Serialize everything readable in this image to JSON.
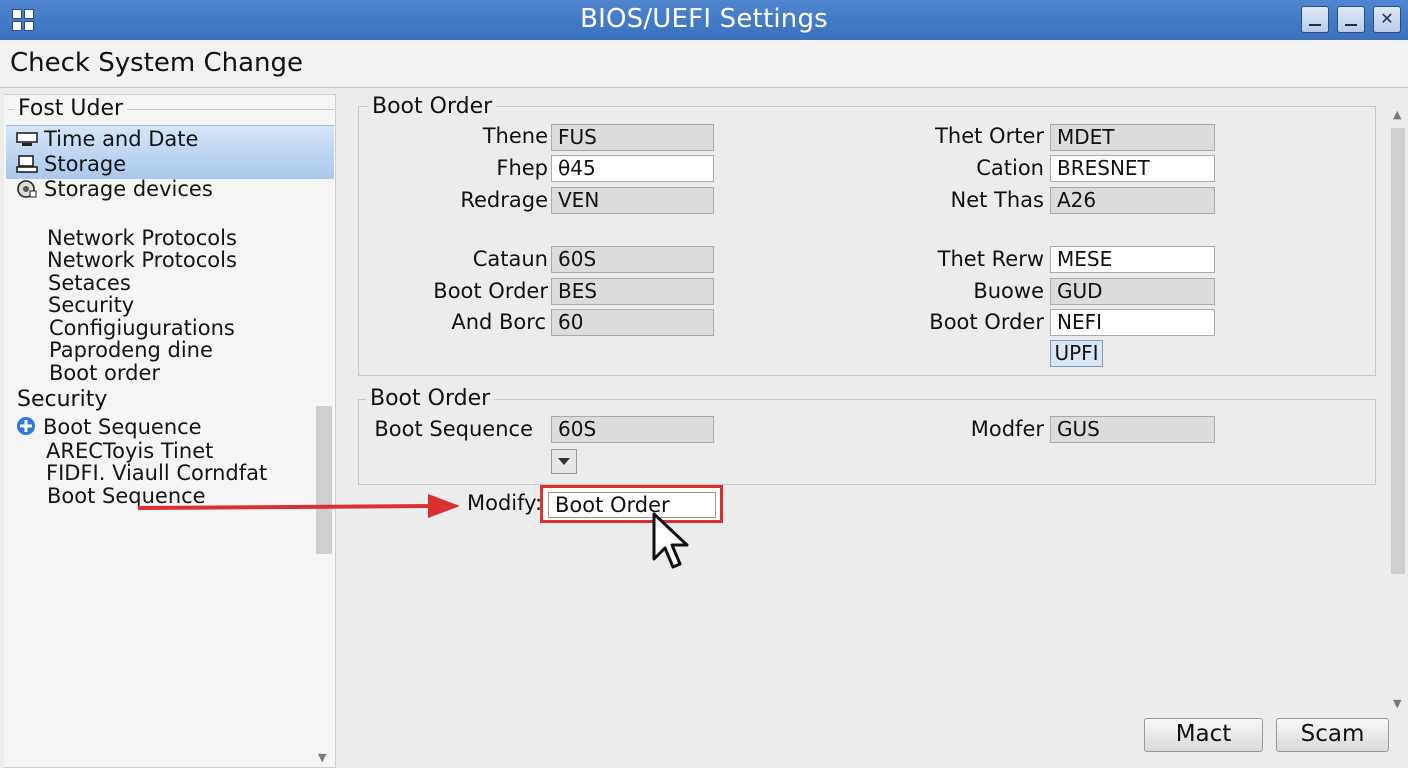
{
  "window": {
    "title": "BIOS/UEFI Settings",
    "min_symbol": "",
    "max_symbol": "",
    "close_symbol": "✕"
  },
  "header": {
    "title": "Check System Change"
  },
  "sidebar": {
    "group1_label": "Fost Uder",
    "group1_items": [
      {
        "label": "Time and Date",
        "icon": "monitor-icon"
      },
      {
        "label": "Storage",
        "icon": "drive-icon"
      },
      {
        "label": "Storage devices",
        "icon": "disk-icon"
      },
      {
        "label": "Network Protocols"
      },
      {
        "label": "Network Protocols"
      },
      {
        "label": "Setaces"
      },
      {
        "label": "Security"
      },
      {
        "label": "Configiugurations"
      },
      {
        "label": "Paprodeng dine"
      },
      {
        "label": "Boot order"
      }
    ],
    "group2_label": "Security",
    "group2_items": [
      {
        "label": "Boot Sequence",
        "icon": "plus-circle-icon"
      },
      {
        "label": "ARECToyis Tinet"
      },
      {
        "label": "FIDFI. Viaull Corndfat"
      },
      {
        "label": "Boot Sequence"
      }
    ]
  },
  "boot_order_group": {
    "title": "Boot Order",
    "left_fields": [
      {
        "label": "Thene",
        "value": "FUS",
        "editable": false
      },
      {
        "label": "Fhep",
        "value": "θ45",
        "editable": true
      },
      {
        "label": "Redrage",
        "value": "VEN",
        "editable": false
      },
      {
        "label": "Cataun",
        "value": "60S",
        "editable": false
      },
      {
        "label": "Boot Order",
        "value": "BES",
        "editable": false
      },
      {
        "label": "And Borc",
        "value": "60",
        "editable": false
      }
    ],
    "right_fields": [
      {
        "label": "Thet Orter",
        "value": "MDET",
        "editable": false
      },
      {
        "label": "Cation",
        "value": "BRESNET",
        "editable": true
      },
      {
        "label": "Net Thas",
        "value": "A26",
        "editable": false
      },
      {
        "label": "Thet Rerw",
        "value": "MESE",
        "editable": true
      },
      {
        "label": "Buowe",
        "value": "GUD",
        "editable": false
      },
      {
        "label": "Boot Order",
        "value": "NEFI",
        "editable": true
      }
    ],
    "extra_button": "UPFI"
  },
  "boot_sequence_group": {
    "title": "Boot Order",
    "seq_label": "Boot Sequence",
    "seq_value": "60S",
    "modifer_label": "Modfer",
    "modifer_value": "GUS"
  },
  "modify": {
    "label": "Modify:",
    "value": "Boot Order"
  },
  "buttons": {
    "mact": "Mact",
    "scam": "Scam"
  },
  "colors": {
    "titlebar": "#3a70bd",
    "selection": "#a9c8ec",
    "arrow": "#d93030"
  }
}
